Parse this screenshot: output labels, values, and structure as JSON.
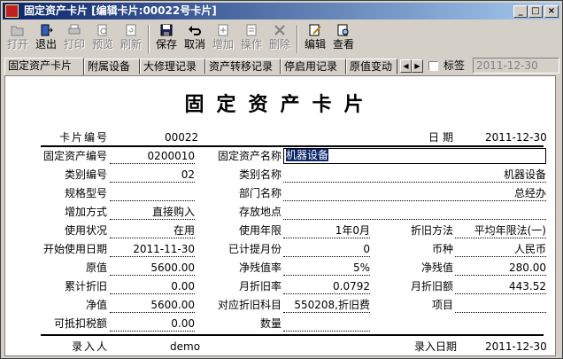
{
  "window": {
    "title": "固定资产卡片 [编辑卡片:00022号卡片]"
  },
  "toolbar": [
    {
      "label": "打开",
      "icon": "folder-open-icon",
      "enabled": false
    },
    {
      "label": "退出",
      "icon": "exit-door-icon",
      "enabled": true
    },
    {
      "label": "打印",
      "icon": "printer-icon",
      "enabled": false
    },
    {
      "label": "预览",
      "icon": "print-preview-icon",
      "enabled": false
    },
    {
      "label": "刷新",
      "icon": "refresh-icon",
      "enabled": false
    },
    {
      "label": "保存",
      "icon": "floppy-save-icon",
      "enabled": true
    },
    {
      "label": "取消",
      "icon": "undo-arrow-icon",
      "enabled": true
    },
    {
      "label": "增加",
      "icon": "add-document-icon",
      "enabled": false
    },
    {
      "label": "操作",
      "icon": "operation-icon",
      "enabled": false
    },
    {
      "label": "删除",
      "icon": "delete-x-icon",
      "enabled": false
    },
    {
      "label": "编辑",
      "icon": "edit-card-icon",
      "enabled": true
    },
    {
      "label": "查看",
      "icon": "view-card-icon",
      "enabled": true
    }
  ],
  "tabs": [
    "固定资产卡片",
    "附属设备",
    "大修理记录",
    "资产转移记录",
    "停启用记录",
    "原值变动"
  ],
  "tag_checkbox": {
    "label": "标签",
    "checked": false
  },
  "top_date": "2011-12-30",
  "card": {
    "heading": "固定资产卡片",
    "card_no_label": "卡片编号",
    "card_no": "00022",
    "date_label": "日期",
    "date": "2011-12-30",
    "asset_no_label": "固定资产编号",
    "asset_no": "0200010",
    "asset_name_label": "固定资产名称",
    "asset_name": "机器设备",
    "category_no_label": "类别编号",
    "category_no": "02",
    "category_name_label": "类别名称",
    "category_name": "机器设备",
    "spec_label": "规格型号",
    "spec": "",
    "dept_label": "部门名称",
    "dept": "总经办",
    "add_method_label": "增加方式",
    "add_method": "直接购入",
    "location_label": "存放地点",
    "location": "",
    "status_label": "使用状况",
    "status": "在用",
    "life_label": "使用年限",
    "life": "1年0月",
    "dep_method_label": "折旧方法",
    "dep_method": "平均年限法(一)",
    "start_date_label": "开始使用日期",
    "start_date": "2011-11-30",
    "months_label": "已计提月份",
    "months": "0",
    "currency_label": "币种",
    "currency": "人民币",
    "orig_label": "原值",
    "orig": "5600.00",
    "salvage_rate_label": "净残值率",
    "salvage_rate": "5%",
    "salvage_label": "净残值",
    "salvage": "280.00",
    "acc_dep_label": "累计折旧",
    "acc_dep": "0.00",
    "month_rate_label": "月折旧率",
    "month_rate": "0.0792",
    "month_amt_label": "月折旧额",
    "month_amt": "443.52",
    "net_label": "净值",
    "net": "5600.00",
    "dep_subject_label": "对应折旧科目",
    "dep_subject": "550208,折旧费",
    "project_label": "项目",
    "project": "",
    "tax_label": "可抵扣税额",
    "tax": "0.00",
    "qty_label": "数量",
    "qty": "",
    "entry_person_label": "录入人",
    "entry_person": "demo",
    "entry_date_label": "录入日期",
    "entry_date": "2011-12-30"
  }
}
